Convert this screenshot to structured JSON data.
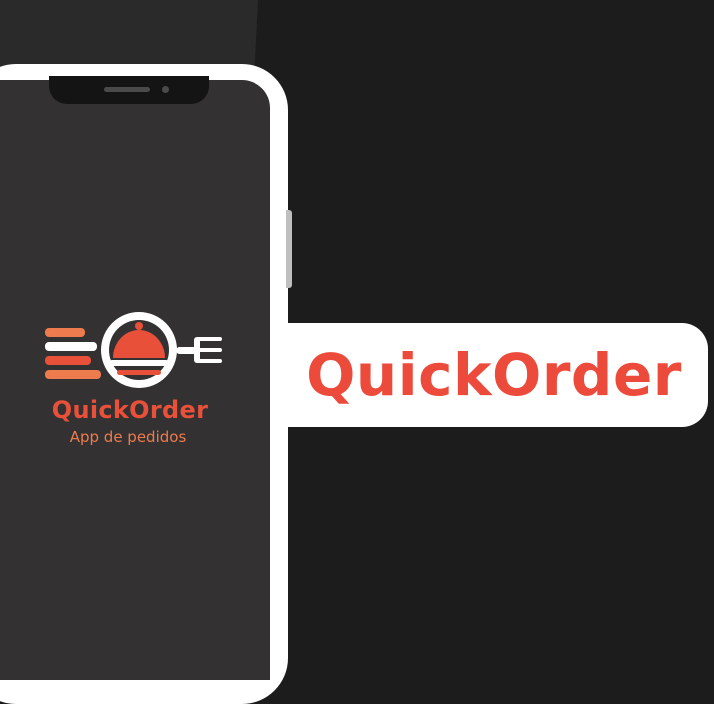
{
  "app": {
    "name": "QuickOrder",
    "subtitle": "App de pedidos",
    "logo_icon": "cloche-fork-speed-logo"
  },
  "banner": {
    "title": "QuickOrder"
  },
  "colors": {
    "background": "#1c1c1c",
    "screen": "#333132",
    "brand_red": "#ec4b3b",
    "brand_orange": "#ee7b4d",
    "phone_frame": "#ffffff"
  }
}
